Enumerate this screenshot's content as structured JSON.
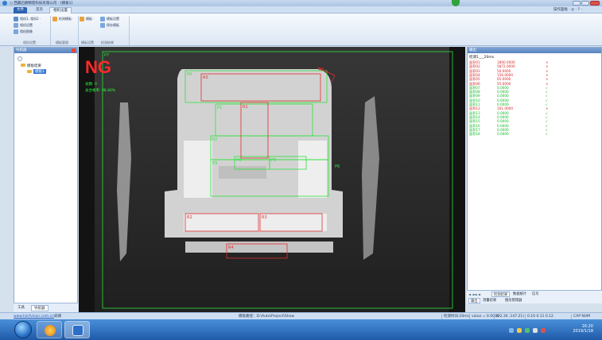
{
  "window": {
    "title": "○ 西藏启爵精密科技有限公司 - [模板1]",
    "min": "",
    "max": "",
    "close": ""
  },
  "ribbon": {
    "tabs": [
      {
        "label": "文件"
      },
      {
        "label": "首页"
      },
      {
        "label": "相机设置"
      }
    ],
    "buttons": {
      "b1": "相机1, 相机2 ·",
      "b2": "相机设置",
      "b3": "相机图像",
      "b4": "检测模板 ·",
      "b5": "模板 ·",
      "b6": "模板设置",
      "b7": "保存模板"
    },
    "groups": {
      "g1": "相机设置",
      "g2": "模板管理",
      "g3": "模板设置",
      "g4": "检测结果"
    },
    "top_right": "操作面板 · ◎ · ? ·"
  },
  "left_panel": {
    "title": "导航器",
    "tree": [
      {
        "label": "模板结果"
      },
      {
        "label": "模板1"
      }
    ],
    "tabs": [
      {
        "label": "工具"
      },
      {
        "label": "导航器"
      }
    ]
  },
  "viewer": {
    "status": "NG",
    "info": [
      "总数: 0",
      "总合格率: 98.80%"
    ],
    "roi_labels": [
      "R0",
      "R1",
      "R2",
      "R3",
      "R4",
      "R5",
      "R6",
      "R7",
      "R8"
    ],
    "green_tags": [
      "P0",
      "P1",
      "P2",
      "P3",
      "P4",
      "P5",
      "P6",
      "P7"
    ]
  },
  "output_panel": {
    "title": "输出",
    "subheader": "检测1___20ms",
    "results": [
      {
        "name": "面积01",
        "value": "1800.0000",
        "status": "×",
        "color": "#d42a2a"
      },
      {
        "name": "面积02",
        "value": "5872.0000",
        "status": "×",
        "color": "#d42a2a"
      },
      {
        "name": "面积03",
        "value": "50.0000",
        "status": "×",
        "color": "#d42a2a"
      },
      {
        "name": "面积04",
        "value": "156.0000",
        "status": "×",
        "color": "#d42a2a"
      },
      {
        "name": "面积05",
        "value": "65.0000",
        "status": "×",
        "color": "#d42a2a"
      },
      {
        "name": "面积06",
        "value": "55.0000",
        "status": "×",
        "color": "#d42a2a"
      },
      {
        "name": "面积07",
        "value": "0.0000",
        "status": "√",
        "color": "#12b824"
      },
      {
        "name": "面积08",
        "value": "0.0000",
        "status": "√",
        "color": "#12b824"
      },
      {
        "name": "面积09",
        "value": "0.0000",
        "status": "√",
        "color": "#12b824"
      },
      {
        "name": "面积10",
        "value": "0.0000",
        "status": "√",
        "color": "#12b824"
      },
      {
        "name": "面积11",
        "value": "0.0000",
        "status": "√",
        "color": "#12b824"
      },
      {
        "name": "面积12",
        "value": "161.0000",
        "status": "×",
        "color": "#d42a2a"
      },
      {
        "name": "面积13",
        "value": "0.0000",
        "status": "√",
        "color": "#12b824"
      },
      {
        "name": "面积14",
        "value": "0.0000",
        "status": "√",
        "color": "#12b824"
      },
      {
        "name": "面积15",
        "value": "0.0000",
        "status": "√",
        "color": "#12b824"
      },
      {
        "name": "面积16",
        "value": "0.0000",
        "status": "√",
        "color": "#12b824"
      },
      {
        "name": "面积17",
        "value": "0.0000",
        "status": "√",
        "color": "#12b824"
      },
      {
        "name": "面积18",
        "value": "0.0000",
        "status": "√",
        "color": "#12b824"
      }
    ],
    "tabs": [
      "检测结果",
      "数据统计",
      "信号"
    ],
    "bottom_tabs": [
      "输出",
      "测量结果",
      "图形管理器"
    ]
  },
  "statusbar": {
    "link": "www.hzsfvison.com.cn",
    "ready": "就绪",
    "path": "模板路径：D:\\Auto\\Project\\Show",
    "time": "检测时间:20ms",
    "vals": [
      "value = 0.0000",
      "(22.30 ,147.21)",
      "0.10  0.11  0.12",
      "CAP NUM"
    ]
  },
  "taskbar": {
    "time": "16:20",
    "date": "2019/1/18"
  },
  "colors": {
    "roi_red": "#e03030",
    "roi_green": "#2ce33c",
    "accent": "#2c63b3",
    "ng": "#ff2a2a"
  }
}
